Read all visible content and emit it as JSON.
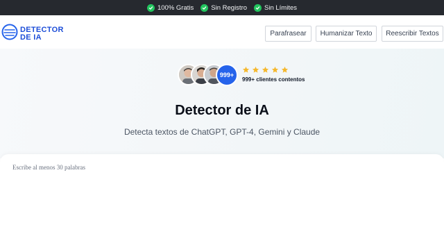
{
  "topbar": {
    "items": [
      {
        "label": "100% Gratis"
      },
      {
        "label": "Sin Registro"
      },
      {
        "label": "Sin Límites"
      }
    ]
  },
  "logo": {
    "line1": "DETECTOR",
    "line2": "DE IA"
  },
  "nav": {
    "buttons": [
      {
        "label": "Parafrasear"
      },
      {
        "label": "Humanizar Texto"
      },
      {
        "label": "Reescribir Textos"
      }
    ]
  },
  "social_proof": {
    "badge": "999+",
    "rating_stars": 5,
    "caption": "999+ clientes contentos"
  },
  "hero": {
    "title": "Detector de IA",
    "subtitle": "Detecta textos de ChatGPT, GPT-4, Gemini y Claude"
  },
  "editor": {
    "placeholder": "Escribe al menos 30 palabras",
    "value": ""
  },
  "colors": {
    "topbar_bg": "#26292f",
    "check_green": "#22c55e",
    "brand_blue": "#2563eb",
    "star_yellow": "#f5b82e"
  },
  "icons": [
    "check-circle-icon",
    "logo-circle-icon",
    "star-icon"
  ]
}
